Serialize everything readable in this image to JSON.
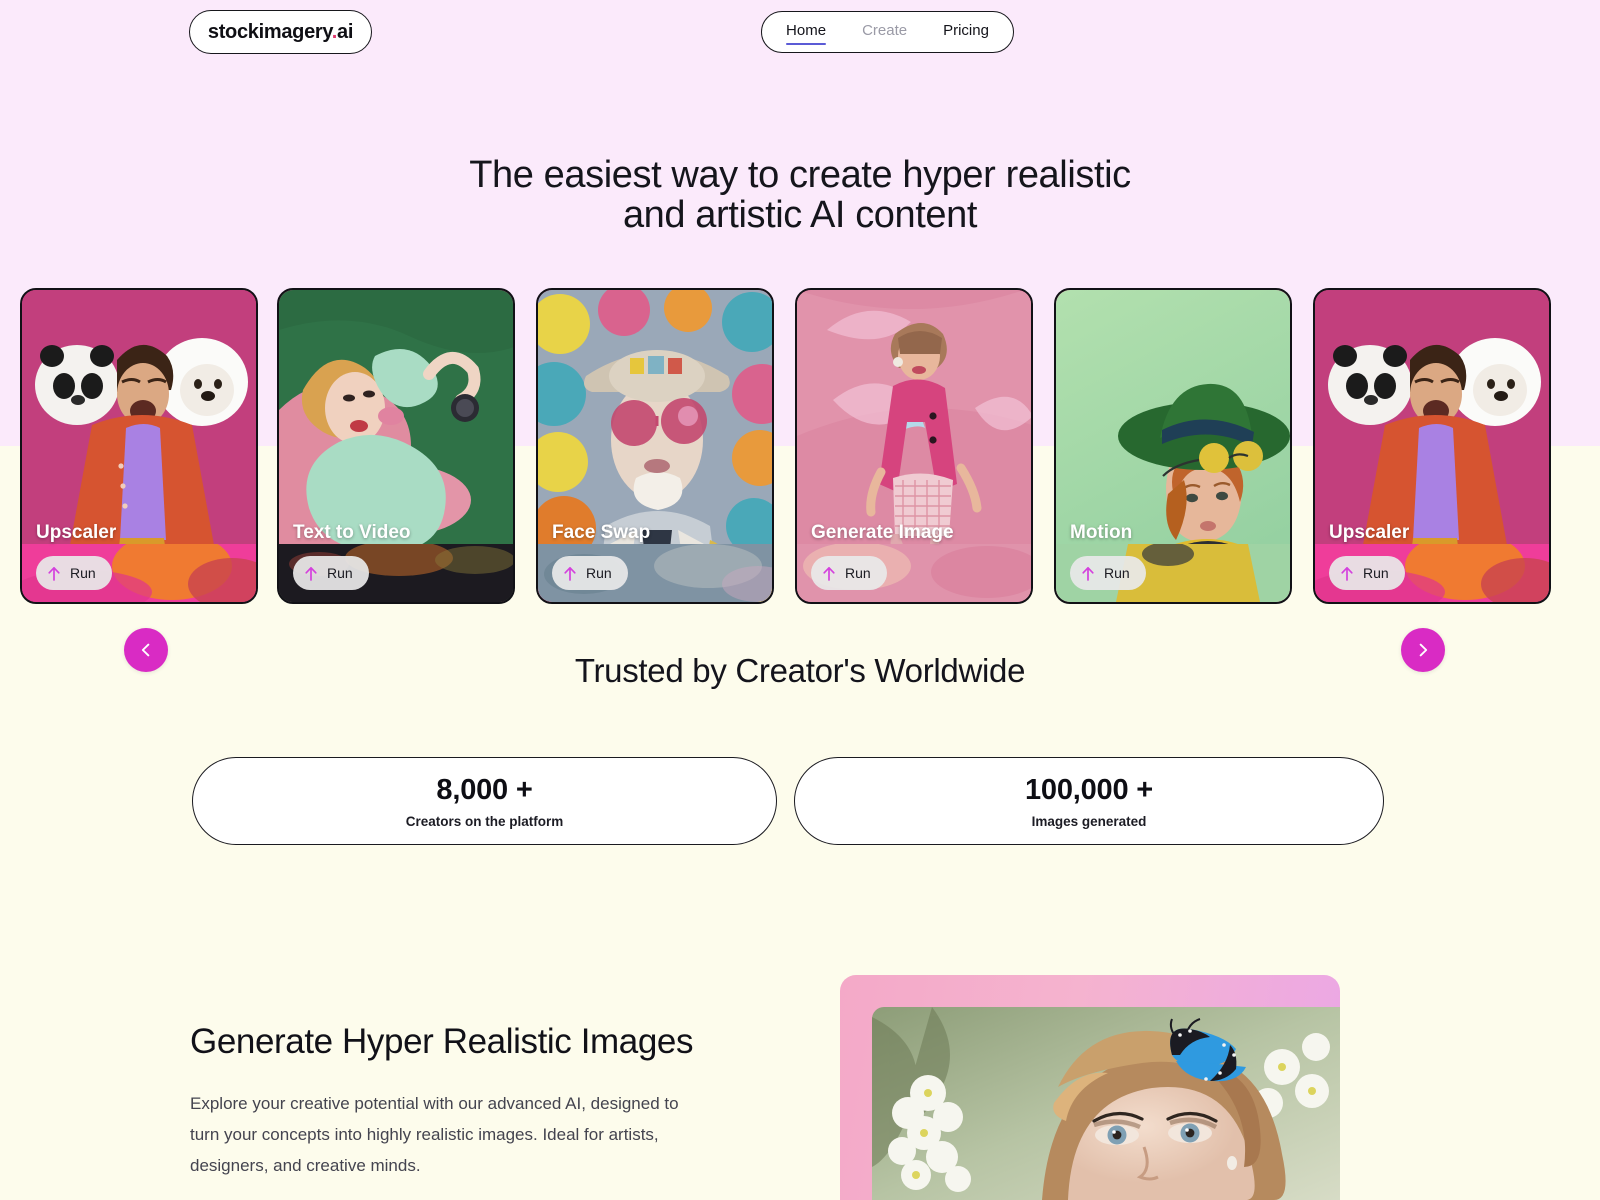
{
  "header": {
    "logo": {
      "name": "stockimagery",
      "dot": ".",
      "tld": "ai"
    },
    "nav": [
      {
        "label": "Home",
        "state": "active"
      },
      {
        "label": "Create",
        "state": "muted"
      },
      {
        "label": "Pricing",
        "state": "default"
      }
    ]
  },
  "hero": {
    "line1": "The easiest way to create hyper realistic",
    "line2": "and artistic AI content"
  },
  "carousel": {
    "prev_icon": "chevron-left-icon",
    "next_icon": "chevron-right-icon",
    "cards": [
      {
        "label": "Upscaler",
        "run_label": "Run",
        "run_icon": "arrow-up-icon",
        "accent": "#c4437f"
      },
      {
        "label": "Text to Video",
        "run_label": "Run",
        "run_icon": "arrow-up-icon",
        "accent": "#2b6b41"
      },
      {
        "label": "Face Swap",
        "run_label": "Run",
        "run_icon": "arrow-up-icon",
        "accent": "#7da6b4"
      },
      {
        "label": "Generate Image",
        "run_label": "Run",
        "run_icon": "arrow-up-icon",
        "accent": "#e2799f"
      },
      {
        "label": "Motion",
        "run_label": "Run",
        "run_icon": "arrow-up-icon",
        "accent": "#9fd6a0"
      },
      {
        "label": "Upscaler",
        "run_label": "Run",
        "run_icon": "arrow-up-icon",
        "accent": "#c4437f"
      }
    ]
  },
  "trusted": {
    "title": "Trusted by Creator's Worldwide",
    "stats": [
      {
        "value": "8,000 +",
        "label": "Creators on the platform"
      },
      {
        "value": "100,000 +",
        "label": "Images generated"
      }
    ]
  },
  "feature": {
    "heading": "Generate Hyper Realistic Images",
    "body": "Explore your creative potential with our advanced AI, designed to turn your concepts into highly realistic images. Ideal for artists, designers, and creative minds."
  },
  "colors": {
    "bg_top": "#fbeafb",
    "bg_bottom": "#fdfcec",
    "accent_magenta": "#d92bc4",
    "nav_active_underline": "#5b5bd6",
    "logo_dot": "#e0396f"
  }
}
